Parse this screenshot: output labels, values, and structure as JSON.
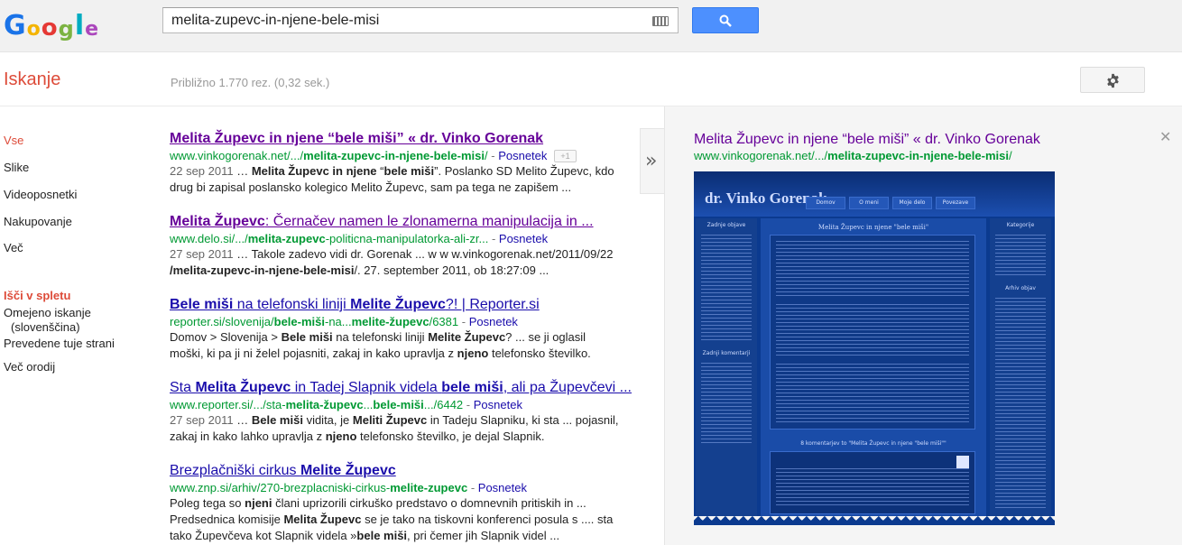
{
  "logo": {
    "letters": [
      "G",
      "o",
      "o",
      "g",
      "l",
      "e"
    ],
    "colors": [
      "#1a73e8",
      "#f4b400",
      "#e53935",
      "#7cb342",
      "#00acc1",
      "#ab47bc"
    ]
  },
  "search": {
    "query": "melita-zupevc-in-njene-bele-misi",
    "keyboard_icon": "keyboard-icon",
    "button_icon": "search-icon"
  },
  "subbar": {
    "title": "Iskanje",
    "stats": "Približno 1.770 rez. (0,32 sek.)",
    "settings_icon": "gear-icon"
  },
  "leftnav": {
    "items": [
      {
        "label": "Vse",
        "active": true
      },
      {
        "label": "Slike"
      },
      {
        "label": "Videoposnetki"
      },
      {
        "label": "Nakupovanje"
      },
      {
        "label": "Več"
      }
    ],
    "tools_heading": "Išči v spletu",
    "tools": [
      "Omejeno iskanje",
      "(slovenščina)",
      "Prevedene tuje strani",
      "Več orodij"
    ]
  },
  "results": [
    {
      "title_parts": [
        "Melita Župevc in njene “bele miši” « dr. Vinko Gorenak"
      ],
      "url_pre": "www.vinkogorenak.net/.../",
      "url_bold": "melita-zupevc-in-njene-bele-misi",
      "url_post": "/",
      "snapshot": "Posnetek",
      "plus1": "+1",
      "date": "22 sep 2011",
      "snippet_l1_a": "Poslanko SD Melito Župevc, kdo",
      "snippet_bold1": "Melita Župevc in njene",
      "snippet_bold2": "bele miši",
      "snippet_l2": "drug bi zapisal poslansko kolegico Melito Župevc, sam pa tega ne zapišem ..."
    },
    {
      "title_bold": "Melita Župevc",
      "title_rest": ": Černačev namen le zlonamerna manipulacija in ...",
      "url_pre": "www.delo.si/.../",
      "url_bold": "melita-zupevc",
      "url_post": "-politicna-manipulatorka-ali-zr...",
      "snapshot": "Posnetek",
      "date": "27 sep 2011",
      "snippet_l1": "Takole zadevo vidi dr. Gorenak ... w w w.vinkogorenak.net/2011/09/22",
      "snippet_l2_bold": "/melita-zupevc-in-njene-bele-misi",
      "snippet_l2_rest": "/. 27. september 2011, ob 18:27:09 ..."
    },
    {
      "title_a": "Bele miši",
      "title_b": " na telefonski liniji ",
      "title_c": "Melite Župevc",
      "title_d": "?! | Reporter.si",
      "url_pre": "reporter.si/slovenija/",
      "url_bold1": "bele-miši",
      "url_mid": "-na...",
      "url_bold2": "melite-župevc",
      "url_post": "/6381",
      "snapshot": "Posnetek",
      "snippet_l1_a": "Domov > Slovenija >",
      "snippet_l1_bold1": "Bele miši",
      "snippet_l1_b": "na telefonski liniji",
      "snippet_l1_bold2": "Melite Župevc",
      "snippet_l1_c": "? ... se ji oglasil",
      "snippet_l2_a": "moški, ki pa ji ni želel pojasniti, zakaj in kako upravlja z",
      "snippet_l2_bold": "njeno",
      "snippet_l2_b": "telefonsko številko."
    },
    {
      "title_a": "Sta ",
      "title_b": "Melita Župevc",
      "title_c": " in Tadej Slapnik videla ",
      "title_d": "bele miši",
      "title_e": ", ali pa Župevčevi ...",
      "url_pre": "www.reporter.si/.../sta-",
      "url_bold1": "melita-župevc",
      "url_mid": "...",
      "url_bold2": "bele-miši",
      "url_post": ".../6442",
      "snapshot": "Posnetek",
      "date": "27 sep 2011",
      "snippet_l1_bold1": "Bele miši",
      "snippet_l1_a": "vidita, je",
      "snippet_l1_bold2": "Meliti Župevc",
      "snippet_l1_b": "in Tadeju Slapniku, ki sta ... pojasnil,",
      "snippet_l2_a": "zakaj in kako lahko upravlja z",
      "snippet_l2_bold": "njeno",
      "snippet_l2_b": "telefonsko številko, je dejal Slapnik."
    },
    {
      "title_a": "Brezplačniški cirkus ",
      "title_b": "Melite Župevc",
      "url_pre": "www.znp.si/arhiv/270-brezplacniski-cirkus-",
      "url_bold": "melite-zupevc",
      "snapshot": "Posnetek",
      "snippet_l1_a": "Poleg tega so",
      "snippet_l1_bold": "njeni",
      "snippet_l1_b": "člani uprizorili cirkuško predstavo o domnevnih pritiskih in ...",
      "snippet_l2_a": "Predsednica komisije",
      "snippet_l2_bold": "Melita Župevc",
      "snippet_l2_b": "se je tako na tiskovni konferenci posula s .... sta",
      "snippet_l3_a": "tako Župevčeva kot Slapnik videla »",
      "snippet_l3_bold": "bele miši",
      "snippet_l3_b": ", pri čemer jih Slapnik videl ..."
    }
  ],
  "preview": {
    "title": "Melita Župevc in njene “bele miši” « dr. Vinko Gorenak",
    "url_pre": "www.vinkogorenak.net/.../",
    "url_bold": "melita-zupevc-in-njene-bele-misi",
    "url_post": "/",
    "close_icon": "close-icon",
    "arrow_icon": "double-chevron-right-icon",
    "shot": {
      "site_name": "dr. Vinko Gorenak",
      "tabs": [
        "Domov",
        "O meni",
        "Moje delo",
        "Povezave"
      ],
      "post_title": "Melita Župevc in njene \"bele miši\"",
      "left_heading": "Zadnje objave",
      "left_heading2": "Zadnji komentarji",
      "right_heading": "Kategorije",
      "right_heading2": "Arhiv objav",
      "comments_heading": "8 komentarjev to \"Melita Župevc in njene \"bele miši\"\""
    }
  }
}
